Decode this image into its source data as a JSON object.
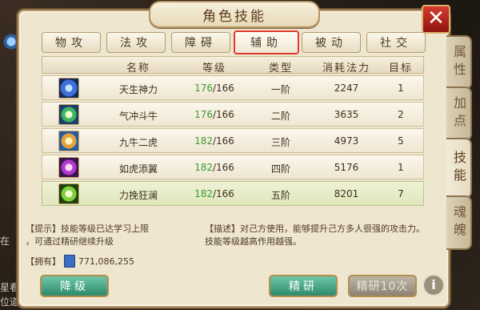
{
  "background": {
    "left_text_1": "在",
    "left_text_2": "星看",
    "left_text_3": "位道"
  },
  "window": {
    "title": "角色技能",
    "close_label": "✕"
  },
  "side_tabs": [
    {
      "label": "属性",
      "active": false
    },
    {
      "label": "加点",
      "active": false
    },
    {
      "label": "技能",
      "active": true
    },
    {
      "label": "魂魄",
      "active": false
    }
  ],
  "tabs": [
    {
      "label": "物攻",
      "active": false
    },
    {
      "label": "法攻",
      "active": false
    },
    {
      "label": "障碍",
      "active": false
    },
    {
      "label": "辅助",
      "active": true
    },
    {
      "label": "被动",
      "active": false
    },
    {
      "label": "社交",
      "active": false
    }
  ],
  "table": {
    "headers": {
      "name": "名称",
      "level": "等级",
      "type": "类型",
      "cost": "消耗法力",
      "target": "目标"
    },
    "rows": [
      {
        "icon": "blue-lightning-skill-icon",
        "name": "天生神力",
        "level_current": "176",
        "level_max": "/166",
        "type": "一阶",
        "cost": "2247",
        "target": "1",
        "selected": false
      },
      {
        "icon": "green-orb-skill-icon",
        "name": "气冲斗牛",
        "level_current": "176",
        "level_max": "/166",
        "type": "二阶",
        "cost": "3635",
        "target": "2",
        "selected": false
      },
      {
        "icon": "golden-aura-skill-icon",
        "name": "九牛二虎",
        "level_current": "182",
        "level_max": "/166",
        "type": "三阶",
        "cost": "4973",
        "target": "5",
        "selected": false
      },
      {
        "icon": "purple-flame-skill-icon",
        "name": "如虎添翼",
        "level_current": "182",
        "level_max": "/166",
        "type": "四阶",
        "cost": "5176",
        "target": "1",
        "selected": false
      },
      {
        "icon": "green-burst-skill-icon",
        "name": "力挽狂澜",
        "level_current": "182",
        "level_max": "/166",
        "type": "五阶",
        "cost": "8201",
        "target": "7",
        "selected": true
      }
    ]
  },
  "hint": {
    "line1": "【提示】技能等级已达学习上限",
    "line2": "，可通过精研继续升级"
  },
  "description": {
    "line1": "【描述】对己方使用，能够提升己方多人很强的攻击力。",
    "line2": "技能等级越高作用越强。"
  },
  "owned": {
    "label": "【拥有】",
    "value": "771,086,255"
  },
  "buttons": {
    "downgrade": "降级",
    "refine": "精研",
    "refine_ten": "精研10次",
    "info": "i"
  },
  "colors": {
    "level_current": "#3b9b2c",
    "active_tab_border": "#e0392f",
    "close_red": "#c2281e",
    "button_green": "#2e8a6c"
  }
}
